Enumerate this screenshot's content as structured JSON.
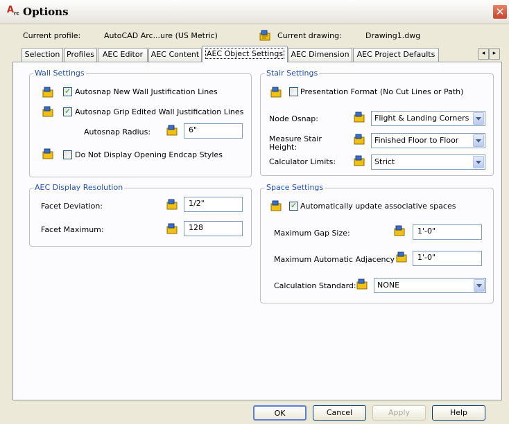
{
  "window": {
    "title": "Options",
    "app_icon": "autocad-architecture-icon",
    "close_glyph": "✕"
  },
  "profile_bar": {
    "profile_label": "Current profile:",
    "profile_value": "AutoCAD Arc...ure (US Metric)",
    "drawing_label": "Current drawing:",
    "drawing_value": "Drawing1.dwg",
    "drawing_icon": "drawing-settings-icon"
  },
  "tabs": [
    {
      "label": "Selection"
    },
    {
      "label": "Profiles"
    },
    {
      "label": "AEC Editor"
    },
    {
      "label": "AEC Content"
    },
    {
      "label": "AEC Object Settings",
      "active": true
    },
    {
      "label": "AEC Dimension"
    },
    {
      "label": "AEC Project Defaults"
    }
  ],
  "tab_scroll": {
    "left": "◂",
    "right": "▸"
  },
  "wall_settings": {
    "title": "Wall Settings",
    "autosnap_new": {
      "label": "Autosnap New Wall Justification Lines",
      "checked": true
    },
    "autosnap_grip": {
      "label": "Autosnap Grip Edited Wall Justification Lines",
      "checked": true
    },
    "autosnap_radius": {
      "label": "Autosnap Radius:",
      "value": "6\""
    },
    "no_endcap": {
      "label": "Do Not Display Opening Endcap Styles",
      "checked": false
    }
  },
  "aec_display": {
    "title": "AEC Display Resolution",
    "facet_deviation": {
      "label": "Facet Deviation:",
      "value": "1/2\""
    },
    "facet_maximum": {
      "label": "Facet Maximum:",
      "value": "128"
    }
  },
  "stair_settings": {
    "title": "Stair Settings",
    "presentation": {
      "label": "Presentation Format (No Cut Lines or Path)",
      "checked": false
    },
    "node_osnap": {
      "label": "Node Osnap:",
      "value": "Flight & Landing Corners"
    },
    "measure_height": {
      "label_line1": "Measure Stair",
      "label_line2": "Height:",
      "value": "Finished Floor to Floor"
    },
    "calc_limits": {
      "label": "Calculator Limits:",
      "value": "Strict"
    }
  },
  "space_settings": {
    "title": "Space Settings",
    "auto_update": {
      "label": "Automatically update associative spaces",
      "checked": true
    },
    "max_gap": {
      "label": "Maximum Gap Size:",
      "value": "1'-0\""
    },
    "max_adjacency": {
      "label": "Maximum Automatic Adjacency",
      "value": "1'-0\""
    },
    "calc_standard": {
      "label": "Calculation Standard:",
      "value": "NONE"
    }
  },
  "buttons": {
    "ok": "OK",
    "cancel": "Cancel",
    "apply": "Apply",
    "help": "Help"
  },
  "colors": {
    "group_title": "#2050b0",
    "checkmark": "#21a121",
    "dialog_bg": "#ece9d8"
  }
}
